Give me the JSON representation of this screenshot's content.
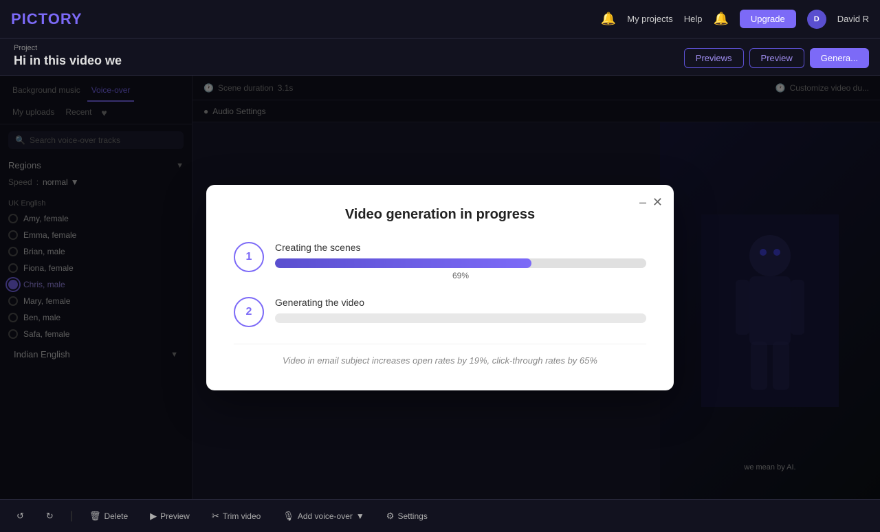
{
  "app": {
    "logo": "tory",
    "logo_full": "PICTORY"
  },
  "navbar": {
    "links": [
      "My projects",
      "Help"
    ],
    "upgrade_label": "Upgrade",
    "user_initial": "D",
    "user_name": "David R"
  },
  "project": {
    "label": "Project",
    "title": "Hi in this video we",
    "btn_previews": "Previews",
    "btn_preview": "Preview",
    "btn_generate": "Genera..."
  },
  "tabs": {
    "items": [
      "Background music",
      "Voice-over",
      "My uploads",
      "Recent"
    ]
  },
  "search": {
    "placeholder": "Search voice-over tracks"
  },
  "regions": {
    "label": "Regions",
    "speed_label": "Speed",
    "speed_value": "normal"
  },
  "voices": {
    "uk_english": {
      "label": "UK English",
      "items": [
        {
          "name": "Amy, female",
          "selected": false
        },
        {
          "name": "Emma, female",
          "selected": false
        },
        {
          "name": "Brian, male",
          "selected": false
        },
        {
          "name": "Fiona, female",
          "selected": false
        },
        {
          "name": "Chris, male",
          "selected": true
        },
        {
          "name": "Mary, female",
          "selected": false
        },
        {
          "name": "Ben, male",
          "selected": false
        },
        {
          "name": "Safa, female",
          "selected": false
        }
      ]
    },
    "indian_english": {
      "label": "Indian English"
    }
  },
  "scene": {
    "duration_label": "Scene duration",
    "duration_value": "3.1s",
    "customize_label": "Customize video du..."
  },
  "audio": {
    "settings_label": "Audio Settings"
  },
  "video_caption": "we mean by AI.",
  "toolbar": {
    "undo_label": "",
    "redo_label": "",
    "delete_label": "Delete",
    "preview_label": "Preview",
    "trim_label": "Trim video",
    "voiceover_label": "Add voice-over",
    "settings_label": "Settings"
  },
  "modal": {
    "title": "Video generation in progress",
    "step1": {
      "number": "1",
      "label": "Creating the scenes",
      "progress": 69,
      "percent_label": "69%"
    },
    "step2": {
      "number": "2",
      "label": "Generating the video",
      "progress": 2
    },
    "tip": "Video in email subject increases open rates by 19%, click-through rates by 65%"
  }
}
